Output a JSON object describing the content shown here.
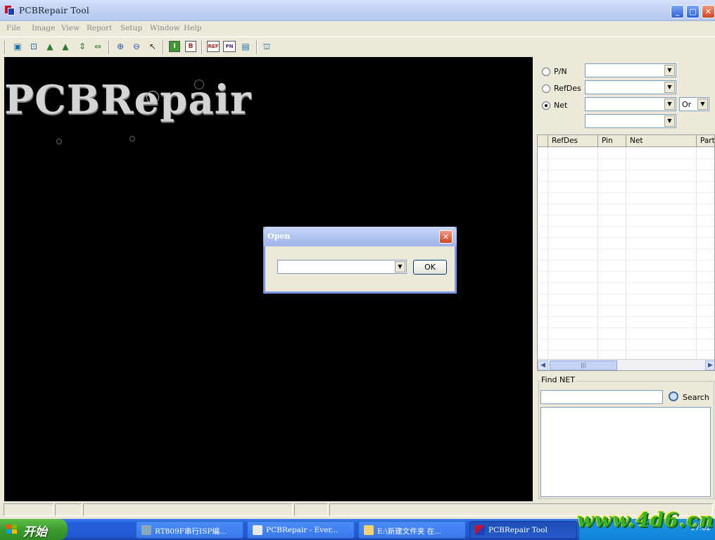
{
  "window": {
    "title": "PCBRepair Tool",
    "minimize": "_",
    "maximize": "□",
    "close": "✕"
  },
  "menu": [
    "File",
    "Image",
    "View",
    "Report",
    "Setup",
    "Window",
    "Help"
  ],
  "toolbar": {
    "ref_badge": "REF",
    "pn_badge": "PN",
    "i_badge": "I",
    "b_badge": "B"
  },
  "canvas": {
    "logo_text": "PCBRepair"
  },
  "filter": {
    "pn_label": "P/N",
    "refdes_label": "RefDes",
    "net_label": "Net",
    "selected": "Net",
    "logic_value": "Or"
  },
  "grid": {
    "columns": [
      "RefDes",
      "Pin",
      "Net",
      "Part"
    ]
  },
  "find": {
    "label": "Find NET",
    "search_label": "Search"
  },
  "dialog": {
    "title": "Open",
    "ok_label": "OK",
    "close": "✕"
  },
  "taskbar": {
    "start_label": "开始",
    "tasks": [
      {
        "label": "RT809F串行ISP编..."
      },
      {
        "label": "PCBRepair - Ever..."
      },
      {
        "label": "E:\\新建文件夹 在..."
      },
      {
        "label": "PCBRepair Tool"
      }
    ],
    "clock": "17:02"
  },
  "watermark": "www.4d6.cn",
  "colors": {
    "canvas_bg": "#000000",
    "titlebar": "#c3d3f4",
    "taskbar": "#245edb",
    "start": "#3c9a2f"
  }
}
